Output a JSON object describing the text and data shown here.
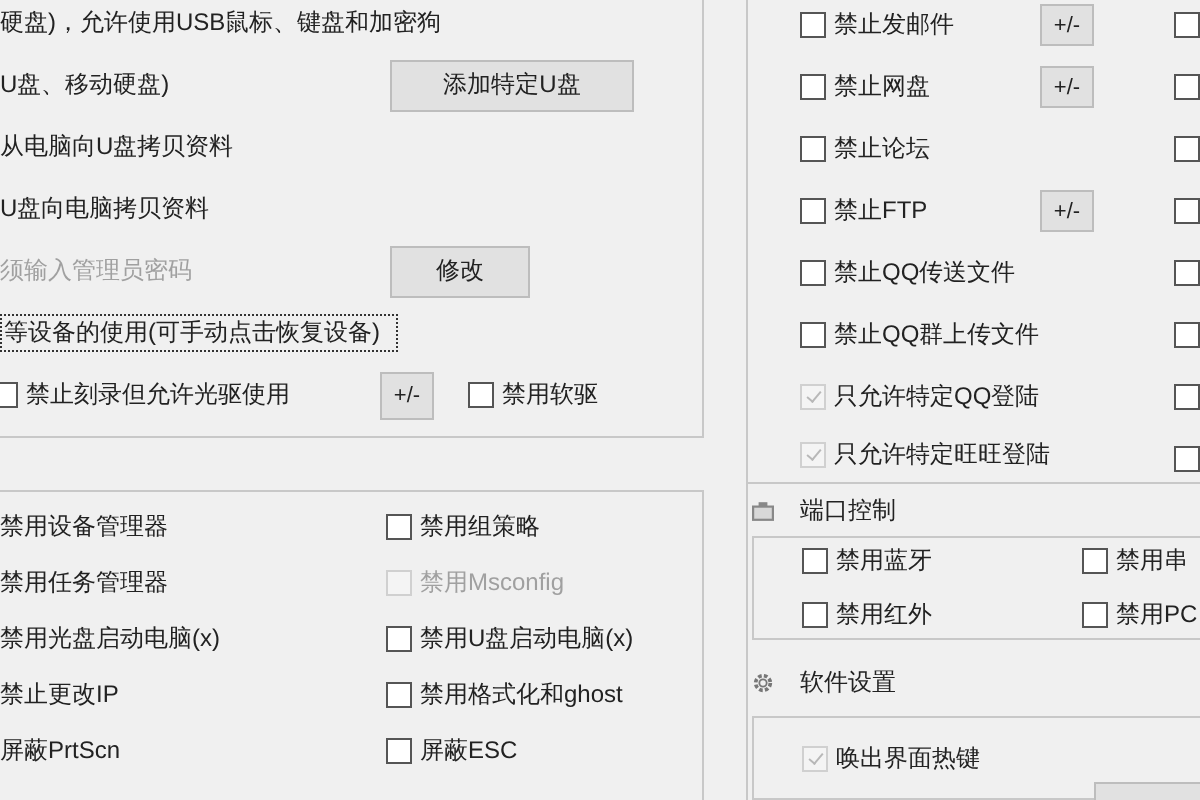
{
  "usb_panel": {
    "rows": [
      {
        "kind": "text",
        "text": "硬盘)，允许使用USB鼠标、键盘和加密狗",
        "disabled": false
      },
      {
        "kind": "text_button",
        "text": "U盘、移动硬盘)",
        "button": "添加特定U盘",
        "disabled": false
      },
      {
        "kind": "text",
        "text": "从电脑向U盘拷贝资料",
        "disabled": false
      },
      {
        "kind": "text",
        "text": "U盘向电脑拷贝资料",
        "disabled": false
      },
      {
        "kind": "text_button",
        "text": "须输入管理员密码",
        "button": "修改",
        "disabled": true
      },
      {
        "kind": "focus_text",
        "text": "等设备的使用(可手动点击恢复设备)",
        "disabled": false
      },
      {
        "kind": "checks",
        "items": [
          {
            "kind": "checkbox",
            "label": "禁止刻录但允许光驱使用",
            "checked": false
          },
          {
            "kind": "button",
            "label": "+/-"
          },
          {
            "kind": "checkbox",
            "label": "禁用软驱",
            "checked": false
          }
        ]
      }
    ]
  },
  "network_panel": {
    "items": [
      {
        "label": "禁止发邮件",
        "checked": false,
        "disabled": false,
        "button": "+/-"
      },
      {
        "label": "禁止网盘",
        "checked": false,
        "disabled": false,
        "button": "+/-"
      },
      {
        "label": "禁止论坛",
        "checked": false,
        "disabled": false
      },
      {
        "label": "禁止FTP",
        "checked": false,
        "disabled": false,
        "button": "+/-"
      },
      {
        "label": "禁止QQ传送文件",
        "checked": false,
        "disabled": false
      },
      {
        "label": "禁止QQ群上传文件",
        "checked": false,
        "disabled": false
      },
      {
        "label": "只允许特定QQ登陆",
        "checked": true,
        "disabled": true
      },
      {
        "label": "只允许特定旺旺登陆",
        "checked": true,
        "disabled": true
      }
    ],
    "edge_checkboxes": [
      {
        "checked": false
      },
      {
        "checked": false
      },
      {
        "checked": false
      },
      {
        "checked": false
      },
      {
        "checked": false
      },
      {
        "checked": false
      },
      {
        "checked": false
      },
      {
        "checked": false
      }
    ]
  },
  "system_panel": {
    "rows": [
      {
        "left": "禁用设备管理器",
        "right": {
          "label": "禁用组策略",
          "checked": false,
          "disabled": false
        }
      },
      {
        "left": "禁用任务管理器",
        "right": {
          "label": "禁用Msconfig",
          "checked": false,
          "disabled": true
        }
      },
      {
        "left": "禁用光盘启动电脑(x)",
        "right": {
          "label": "禁用U盘启动电脑(x)",
          "checked": false,
          "disabled": false
        }
      },
      {
        "left": "禁止更改IP",
        "right": {
          "label": "禁用格式化和ghost",
          "checked": false,
          "disabled": false
        }
      },
      {
        "left": "屏蔽PrtScn",
        "right": {
          "label": "屏蔽ESC",
          "checked": false,
          "disabled": false
        }
      }
    ]
  },
  "port_control": {
    "title": "端口控制",
    "items": [
      {
        "label": "禁用蓝牙",
        "checked": false
      },
      {
        "label": "禁用串",
        "checked": false
      },
      {
        "label": "禁用红外",
        "checked": false
      },
      {
        "label": "禁用PC",
        "checked": false
      }
    ]
  },
  "software_settings": {
    "title": "软件设置",
    "items": [
      {
        "label": "唤出界面热键",
        "checked": true,
        "disabled": true
      }
    ]
  }
}
